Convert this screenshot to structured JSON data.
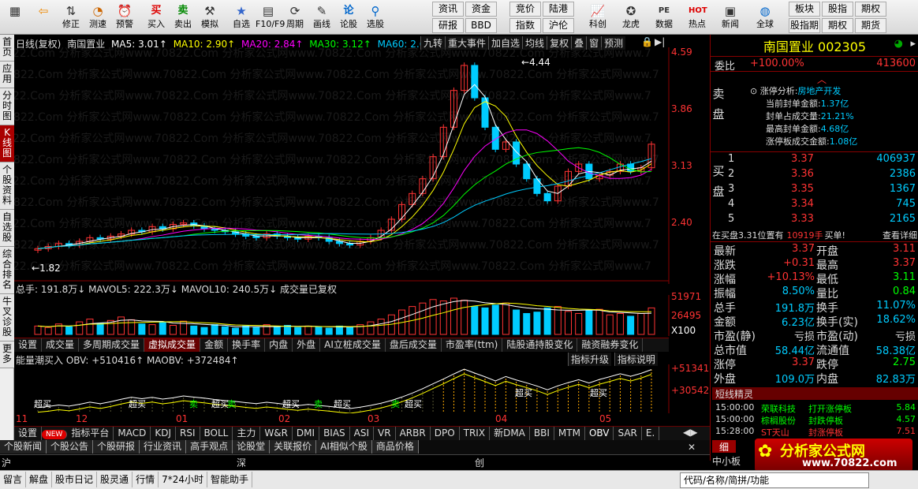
{
  "toolbar": {
    "buttons": [
      {
        "label": "",
        "icon": "grid-icon"
      },
      {
        "label": "",
        "icon": "back-arrow-icon"
      },
      {
        "label": "修正",
        "icon": "up-down-icon"
      },
      {
        "label": "测速",
        "icon": "clock-icon"
      },
      {
        "label": "预警",
        "icon": "alarm-icon"
      },
      {
        "label": "买入",
        "icon": "buy-icon",
        "text": "买"
      },
      {
        "label": "卖出",
        "icon": "sell-icon",
        "text": "卖"
      },
      {
        "label": "模拟",
        "icon": "hammer-icon"
      },
      {
        "label": "自选",
        "icon": "star-icon"
      },
      {
        "label": "F10/F9",
        "icon": "f10-icon"
      },
      {
        "label": "周期",
        "icon": "cycle-icon"
      },
      {
        "label": "画线",
        "icon": "pencil-icon"
      },
      {
        "label": "论股",
        "icon": "discuss-icon",
        "text": "论"
      },
      {
        "label": "选股",
        "icon": "magnifier-icon"
      }
    ],
    "grid1": [
      "资讯",
      "资金",
      "研报",
      "BBD"
    ],
    "grid2": [
      "竞价",
      "陆港",
      "指数",
      "沪伦"
    ],
    "buttons2": [
      {
        "label": "科创",
        "icon": "chart-icon"
      },
      {
        "label": "龙虎",
        "icon": "dragon-icon"
      },
      {
        "label": "数据",
        "icon": "pe-icon",
        "text": "PE"
      },
      {
        "label": "热点",
        "icon": "hot-icon",
        "text": "HOT"
      },
      {
        "label": "新闻",
        "icon": "news-icon"
      },
      {
        "label": "全球",
        "icon": "globe-icon"
      }
    ],
    "grid3": [
      "板块",
      "股指",
      "期权",
      "股指期",
      "期权",
      "期货"
    ]
  },
  "lefttabs": [
    "首页",
    "应用",
    "分时图",
    "K线图",
    "个股资料",
    "自选股",
    "综合排名",
    "牛叉诊股",
    "更多"
  ],
  "chart": {
    "header_left": "日线(复权)",
    "stock_name": "南国置业",
    "ma5": "MA5: 3.01↑",
    "ma10": "MA10: 2.90↑",
    "ma20": "MA20: 2.84↑",
    "ma30": "MA30: 3.12↑",
    "ma60": "MA60: 2.68↑",
    "tools": [
      "九转",
      "重大事件",
      "加自选",
      "均线",
      "复权",
      "叠",
      "窗",
      "预测"
    ],
    "price_axis": [
      "4.59",
      "3.86",
      "3.13",
      "2.40"
    ],
    "high_label": "4.44",
    "low_label": "1.82",
    "watermark": "0822.Com 分析家公式网www.70822.Com 分析家公式网www.70822.Com 分析家公式网www.70822.Com 分析家公式网www.7",
    "volume_header": "总手: 191.8万↓ MAVOL5: 222.3万↓ MAVOL10: 240.5万↓ 成交量已复权",
    "vol_axis": [
      "51971",
      "26495",
      "X100"
    ],
    "sub_tabs": [
      "设置",
      "成交量",
      "多周期成交量",
      "虚拟成交量",
      "金额",
      "换手率",
      "内盘",
      "外盘",
      "AI立桩成交量",
      "盘后成交量",
      "市盈率(ttm)",
      "陆股通持股变化",
      "融资融券变化"
    ],
    "sub_active": 3,
    "obv_header": "能量潮买入 OBV: +510416↑ MAOBV: +372484↑",
    "obv_buttons": [
      "指标升级",
      "指标说明"
    ],
    "obv_axis": [
      "+513415",
      "+305429"
    ],
    "obv_signals": [
      "超买",
      "超买",
      "超买",
      "超买",
      "超买",
      "超买",
      "超买",
      "超买"
    ],
    "obv_sell": [
      "卖",
      "卖",
      "卖",
      "卖"
    ],
    "months": [
      "11",
      "12",
      "01",
      "02",
      "03",
      "04",
      "05"
    ]
  },
  "chart_data": {
    "type": "candlestick",
    "ylim": [
      1.6,
      4.6
    ],
    "closes": [
      1.95,
      1.98,
      2.02,
      2.0,
      2.05,
      2.1,
      2.08,
      2.12,
      2.15,
      2.2,
      2.18,
      2.25,
      2.22,
      2.28,
      2.3,
      2.26,
      2.22,
      2.2,
      2.18,
      2.15,
      2.12,
      2.1,
      2.15,
      2.12,
      2.1,
      2.08,
      2.12,
      2.1,
      2.05,
      2.02,
      2.0,
      2.05,
      2.1,
      2.2,
      2.35,
      2.55,
      2.7,
      2.9,
      3.2,
      3.6,
      4.1,
      4.44,
      4.0,
      3.6,
      3.3,
      3.4,
      3.1,
      2.9,
      2.7,
      2.6,
      2.8,
      3.0,
      3.1,
      2.9,
      2.95,
      3.0,
      3.1,
      3.0,
      3.05,
      3.37
    ],
    "volumes": [
      12,
      10,
      15,
      11,
      18,
      22,
      16,
      20,
      25,
      21,
      15,
      14,
      18,
      13,
      19,
      12,
      10,
      14,
      11,
      9,
      12,
      10,
      14,
      11,
      13,
      10,
      12,
      11,
      9,
      12,
      10,
      14,
      18,
      22,
      28,
      35,
      40,
      45,
      50,
      48,
      52,
      49,
      40,
      38,
      42,
      45,
      35,
      30,
      32,
      38,
      40,
      33,
      30,
      34,
      36,
      28,
      30,
      26,
      30,
      38
    ],
    "obv_note": "OBV rising"
  },
  "right": {
    "name": "南国置业",
    "code": "002305",
    "webi_label": "委比",
    "webi_val": "+100.00%",
    "webi_num": "413600",
    "limit": [
      {
        "k": "涨停分析:",
        "v": "房地产开发"
      },
      {
        "k": "当前封单金额:",
        "v": "1.37亿"
      },
      {
        "k": "封单占成交量:",
        "v": "21.21%"
      },
      {
        "k": "最高封单金额:",
        "v": "4.68亿"
      },
      {
        "k": "涨停板成交金额:",
        "v": "1.08亿"
      }
    ],
    "sell_label": "卖盘",
    "buy_label": "买盘",
    "bids": [
      {
        "n": "1",
        "p": "3.37",
        "q": "406937"
      },
      {
        "n": "2",
        "p": "3.36",
        "q": "2386"
      },
      {
        "n": "3",
        "p": "3.35",
        "q": "1367"
      },
      {
        "n": "4",
        "p": "3.34",
        "q": "745"
      },
      {
        "n": "5",
        "p": "3.33",
        "q": "2165"
      }
    ],
    "note1": "在买盘3.31位置有",
    "note2": "10919手",
    "note3": "买单!",
    "note4": "查看详细",
    "stats": [
      {
        "a": "最新",
        "b": "3.37",
        "c": "开盘",
        "d": "3.11"
      },
      {
        "a": "涨跌",
        "b": "+0.31",
        "c": "最高",
        "d": "3.37"
      },
      {
        "a": "涨幅",
        "b": "+10.13%",
        "c": "最低",
        "d": "3.11"
      },
      {
        "a": "振幅",
        "b": "8.50%",
        "c": "量比",
        "d": "0.84"
      },
      {
        "a": "总手",
        "b": "191.8万",
        "c": "换手",
        "d": "11.07%"
      },
      {
        "a": "金额",
        "b": "6.23亿",
        "c": "换手(实)",
        "d": "18.62%"
      },
      {
        "a": "市盈(静)",
        "b": "亏损",
        "c": "市盈(动)",
        "d": "亏损"
      },
      {
        "a": "总市值",
        "b": "58.44亿",
        "c": "流通值",
        "d": "58.38亿"
      },
      {
        "a": "涨停",
        "b": "3.37",
        "c": "跌停",
        "d": "2.75"
      },
      {
        "a": "外盘",
        "b": "109.0万",
        "c": "内盘",
        "d": "82.83万"
      }
    ],
    "jingling": "短线精灵",
    "alerts": [
      {
        "t": "15:00:00",
        "n": "荣联科技",
        "s": "打开涨停板",
        "v": "5.84"
      },
      {
        "t": "15:00:00",
        "n": "棕榈股份",
        "s": "封跌停板",
        "v": "4.57"
      },
      {
        "t": "15:28:00",
        "n": "ST天山",
        "s": "封涨停板",
        "v": "7.51"
      }
    ],
    "tab_detail": "细",
    "tab_block": "中小板",
    "brand": "分析家公式网",
    "brand_url": "www.70822.com"
  },
  "indicators": [
    "设置",
    "NEW",
    "指标平台",
    "MACD",
    "KDJ",
    "RSI",
    "BOLL",
    "主力",
    "W&R",
    "DMI",
    "BIAS",
    "ASI",
    "VR",
    "ARBR",
    "DPO",
    "TRIX",
    "新DMA",
    "BBI",
    "MTM",
    "OBV",
    "SAR",
    "E."
  ],
  "news_tabs": [
    "个股新闻",
    "个股公告",
    "个股研报",
    "行业资讯",
    "高手观点",
    "论股堂",
    "关联报价",
    "AI相似个股",
    "商品价格"
  ],
  "index_labels": [
    "沪",
    "深",
    "创"
  ],
  "status": [
    "留言",
    "解盘",
    "股市日记",
    "股灵通",
    "行情",
    "7*24小时",
    "智能助手"
  ],
  "status_search": "代码/名称/简拼/功能"
}
